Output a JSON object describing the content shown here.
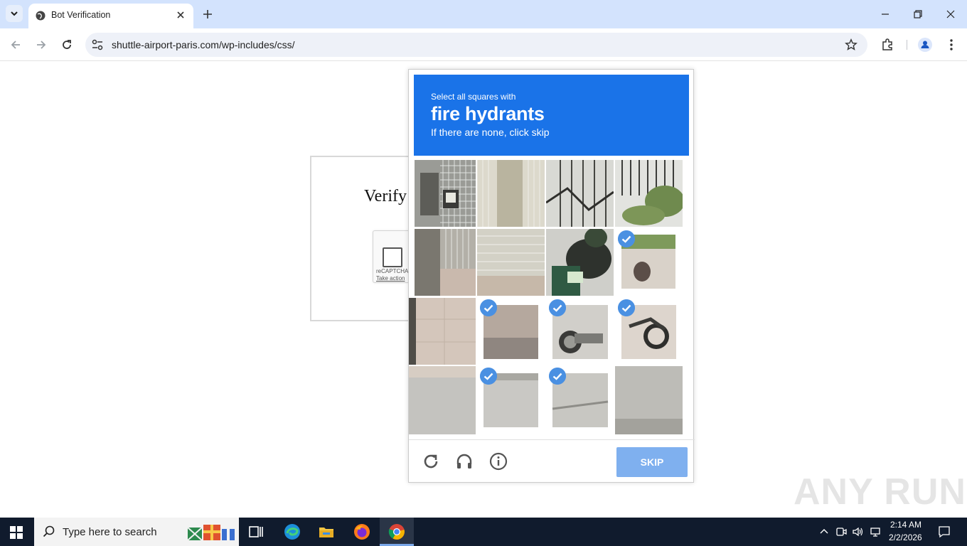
{
  "browser": {
    "tab_title": "Bot Verification",
    "url": "shuttle-airport-paris.com/wp-includes/css/"
  },
  "page": {
    "heading": "Verify",
    "recaptcha_brand": "reCAPTCHA",
    "recaptcha_action": "Take action"
  },
  "challenge": {
    "instruction_small": "Select all squares with",
    "target": "fire hydrants",
    "hint": "If there are none, click skip",
    "skip_label": "SKIP",
    "selected_tiles": [
      8,
      10,
      11,
      12,
      14,
      15
    ]
  },
  "watermark": "ANY RUN",
  "taskbar": {
    "search_placeholder": "Type here to search",
    "time": "2:14 AM",
    "date": "2/2/2026"
  },
  "colors": {
    "accent_blue": "#1a73e8",
    "skip_button": "#7fb0ef",
    "tab_strip": "#d3e3fd",
    "taskbar": "#101b2d"
  }
}
